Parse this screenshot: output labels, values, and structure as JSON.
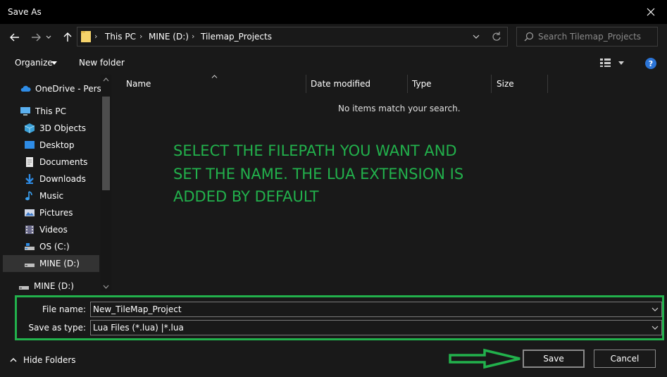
{
  "window": {
    "title": "Save As"
  },
  "address": {
    "crumbs": [
      "This PC",
      "MINE (D:)",
      "Tilemap_Projects"
    ]
  },
  "search": {
    "placeholder": "Search Tilemap_Projects"
  },
  "toolbar": {
    "organize_label": "Organize",
    "new_folder_label": "New folder",
    "help_label": "?"
  },
  "nav": {
    "items": [
      {
        "label": "OneDrive - Persor",
        "icon": "cloud-icon"
      },
      {
        "label": "This PC",
        "icon": "computer-icon"
      },
      {
        "label": "3D Objects",
        "icon": "cube-icon"
      },
      {
        "label": "Desktop",
        "icon": "desktop-icon"
      },
      {
        "label": "Documents",
        "icon": "document-icon"
      },
      {
        "label": "Downloads",
        "icon": "download-icon"
      },
      {
        "label": "Music",
        "icon": "music-icon"
      },
      {
        "label": "Pictures",
        "icon": "pictures-icon"
      },
      {
        "label": "Videos",
        "icon": "videos-icon"
      },
      {
        "label": "OS (C:)",
        "icon": "drive-icon"
      },
      {
        "label": "MINE (D:)",
        "icon": "drive-icon"
      },
      {
        "label": "MINE (D:)",
        "icon": "drive-icon"
      }
    ]
  },
  "columns": [
    "Name",
    "Date modified",
    "Type",
    "Size"
  ],
  "content": {
    "empty_message": "No items match your search.",
    "note_lines": [
      "SELECT THE FILEPATH YOU WANT AND",
      "SET THE NAME. THE LUA EXTENSION IS",
      "ADDED BY DEFAULT"
    ]
  },
  "form": {
    "file_name_label": "File name:",
    "file_name_value": "New_TileMap_Project",
    "save_type_label": "Save as type:",
    "save_type_value": "Lua Files (*.lua) |*.lua"
  },
  "footer": {
    "hide_folders_label": "Hide Folders",
    "save_label": "Save",
    "cancel_label": "Cancel"
  },
  "colors": {
    "annotation": "#22b14c",
    "background": "#191919",
    "titlebar": "#000000",
    "folder": "#f5d36b"
  }
}
